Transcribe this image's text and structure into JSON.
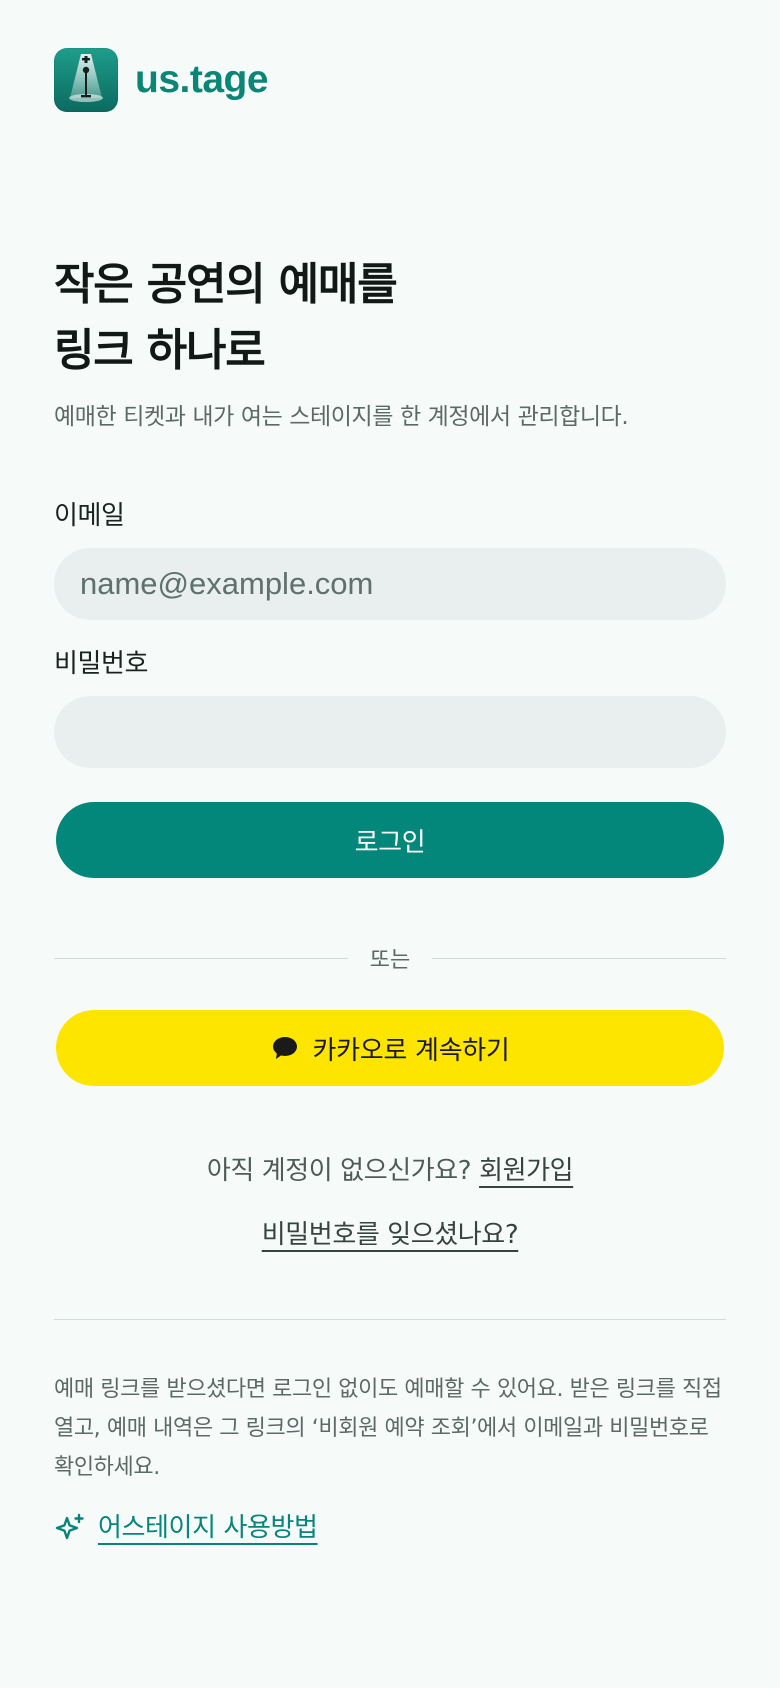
{
  "brand": {
    "name": "us.tage",
    "logo_icon": "spotlight-microphone-icon"
  },
  "hero": {
    "title_line1": "작은 공연의 예매를",
    "title_line2": "링크 하나로",
    "subtitle": "예매한 티켓과 내가 여는 스테이지를 한 계정에서 관리합니다."
  },
  "form": {
    "email_label": "이메일",
    "email_placeholder": "name@example.com",
    "email_value": "",
    "password_label": "비밀번호",
    "password_placeholder": "",
    "password_value": "",
    "login_button": "로그인"
  },
  "divider": {
    "text": "또는"
  },
  "kakao": {
    "button_label": "카카오로 계속하기",
    "icon": "speech-bubble-icon",
    "color": "#fee500"
  },
  "account": {
    "signup_prompt": "아직 계정이 없으신가요?",
    "signup_link": "회원가입",
    "forgot_password": "비밀번호를 잊으셨나요?"
  },
  "guest_note": "예매 링크를 받으셨다면 로그인 없이도 예매할 수 있어요. 받은 링크를 직접 열고, 예매 내역은 그 링크의 ‘비회원 예약 조회’에서 이메일과 비밀번호로 확인하세요.",
  "guide": {
    "label": "어스테이지 사용방법",
    "icon": "sparkle-icon"
  },
  "colors": {
    "accent": "#02877a",
    "brand_text": "#0b8576",
    "background": "#f6faf9",
    "input_bg": "#e9efee",
    "kakao_yellow": "#fee500"
  }
}
